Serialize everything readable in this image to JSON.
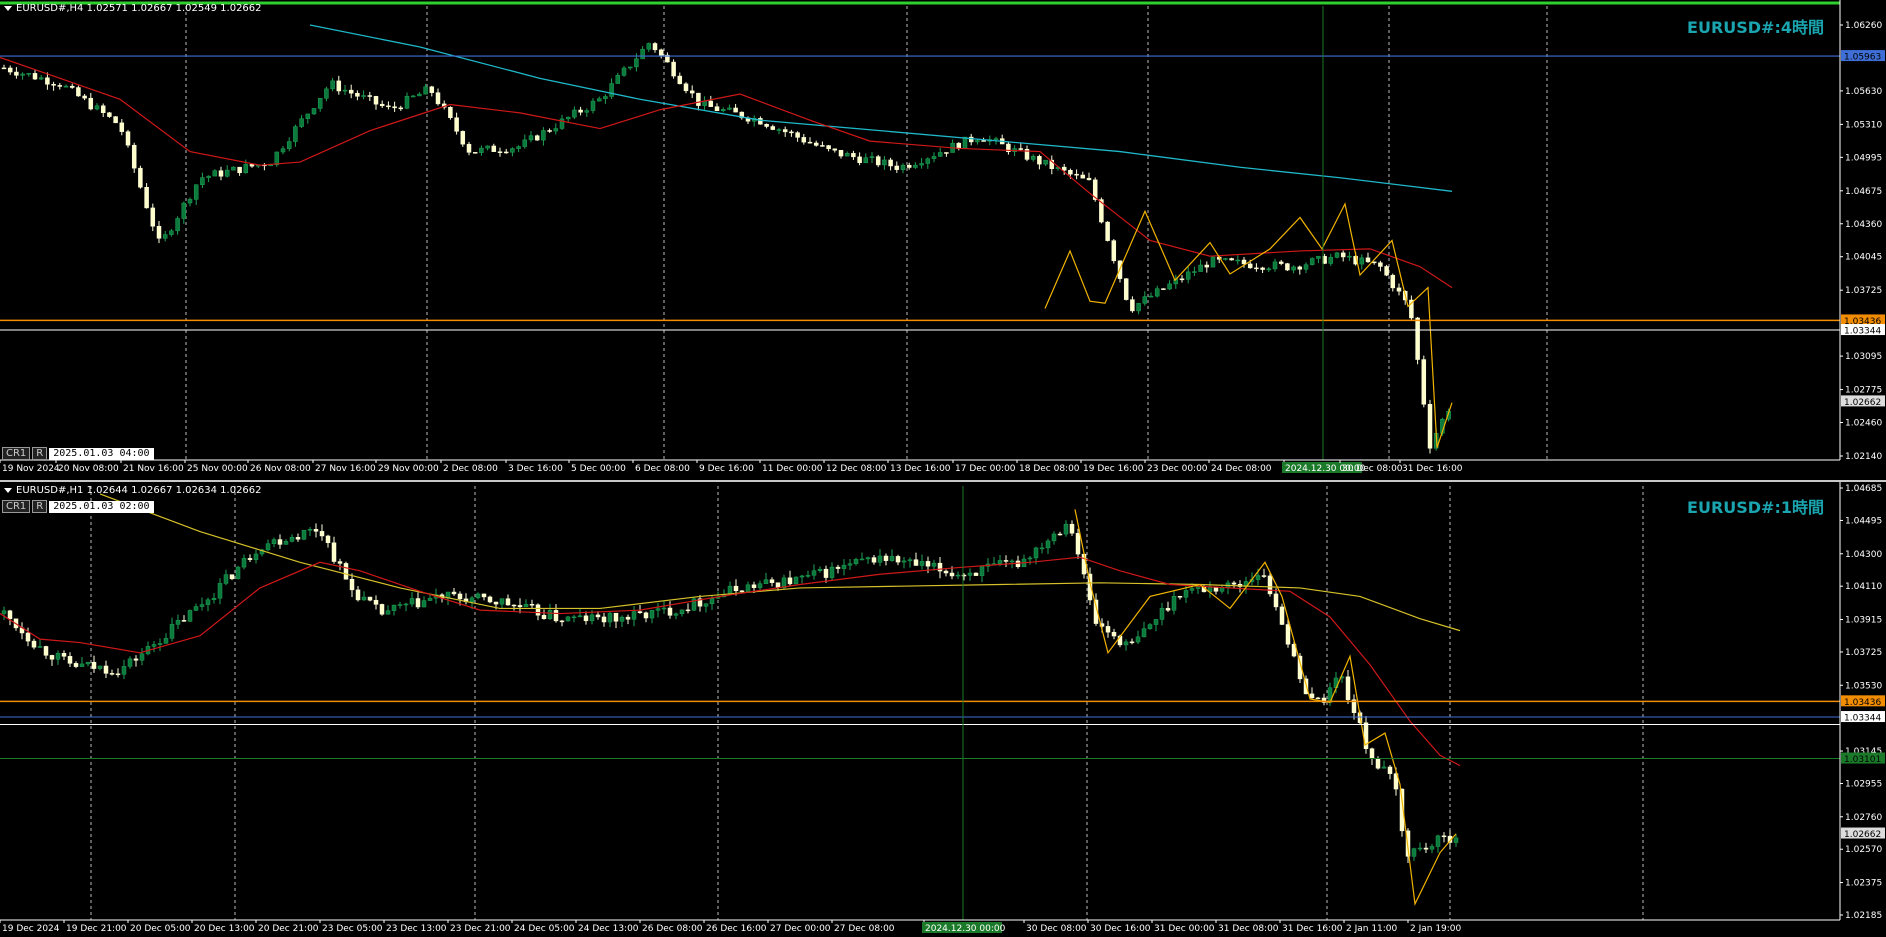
{
  "top_chart": {
    "header": "EURUSD#,H4  1.02571 1.02667 1.02549 1.02662",
    "title": "EURUSD#:4時間",
    "cr_box": "CR1",
    "r_box": "R",
    "timestamp": "2025.01.03 04:00",
    "price_labels": [
      "1.06260",
      "1.05963",
      "1.05630",
      "1.05310",
      "1.04995",
      "1.04675",
      "1.04360",
      "1.04045",
      "1.03725",
      "1.03436",
      "1.03344",
      "1.03095",
      "1.02775",
      "1.02662",
      "1.02460",
      "1.02140"
    ],
    "time_labels": [
      "19 Nov 2024",
      "20 Nov 08:00",
      "21 Nov 16:00",
      "25 Nov 00:00",
      "26 Nov 08:00",
      "27 Nov 16:00",
      "29 Nov 00:00",
      "2 Dec 08:00",
      "3 Dec 16:00",
      "5 Dec 00:00",
      "6 Dec 08:00",
      "9 Dec 16:00",
      "11 Dec 00:00",
      "12 Dec 08:00",
      "13 Dec 16:00",
      "17 Dec 00:00",
      "18 Dec 08:00",
      "19 Dec 16:00",
      "23 Dec 00:00",
      "24 Dec 08:00",
      "2024.12.30 00:00",
      "30 Dec 08:00",
      "31 Dec 16:00"
    ],
    "crosshair_time": "2024.12.30 00:00"
  },
  "bottom_chart": {
    "header": "EURUSD#,H1  1.02644 1.02667 1.02634 1.02662",
    "title": "EURUSD#:1時間",
    "cr_box": "CR1",
    "r_box": "R",
    "timestamp": "2025.01.03 02:00",
    "price_labels": [
      "1.04685",
      "1.04495",
      "1.04300",
      "1.04110",
      "1.03915",
      "1.03725",
      "1.03530",
      "1.03436",
      "1.03344",
      "1.03145",
      "1.03101",
      "1.02955",
      "1.02760",
      "1.02662",
      "1.02570",
      "1.02375",
      "1.02185"
    ],
    "time_labels": [
      "19 Dec 2024",
      "19 Dec 21:00",
      "20 Dec 05:00",
      "20 Dec 13:00",
      "20 Dec 21:00",
      "23 Dec 05:00",
      "23 Dec 13:00",
      "23 Dec 21:00",
      "24 Dec 05:00",
      "24 Dec 13:00",
      "26 Dec 08:00",
      "26 Dec 16:00",
      "27 Dec 00:00",
      "27 Dec 08:00",
      "2024.12.30 00:00",
      "30 Dec 08:00",
      "30 Dec 16:00",
      "31 Dec 00:00",
      "31 Dec 08:00",
      "31 Dec 16:00",
      "2 Jan 11:00",
      "2 Jan 19:00"
    ],
    "crosshair_time": "2024.12.30 00:00"
  },
  "colors": {
    "bull": "#0b7a3c",
    "bear": "#ffffcc",
    "ma_fast": "#d01818",
    "ma_slow_h4": "#1fb7c9",
    "ma_slow_h1": "#d6c12a",
    "zigzag": "#f2b400",
    "level_orange": "#f28c00",
    "level_blue": "#3f6fd6",
    "title": "#1aa5b0"
  }
}
